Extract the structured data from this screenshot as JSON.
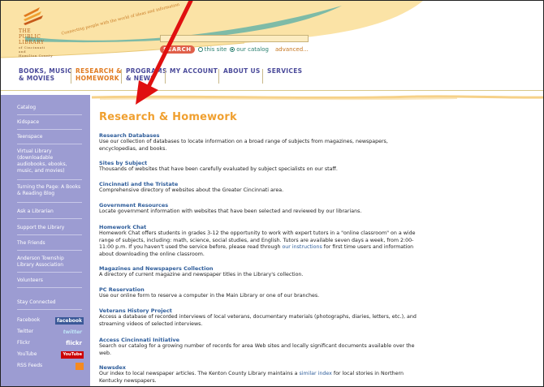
{
  "logo": {
    "line1": "THE",
    "line2": "PUBLIC",
    "line3": "LIBRARY",
    "line4": "of Cincinnati",
    "line5": "and",
    "line6": "Hamilton County",
    "tagline": "Connecting people with the world of ideas and information"
  },
  "search": {
    "button_label": "SEARCH",
    "option_site": "this site",
    "option_catalog": "our catalog",
    "advanced_label": "advanced...",
    "selected": "our catalog"
  },
  "nav": {
    "items": [
      {
        "line1": "BOOKS, MUSIC",
        "line2": "& MOVIES"
      },
      {
        "line1": "RESEARCH &",
        "line2": "HOMEWORK"
      },
      {
        "line1": "PROGRAMS",
        "line2": "& NEWS"
      },
      {
        "line1": "MY ACCOUNT",
        "line2": ""
      },
      {
        "line1": "ABOUT US",
        "line2": ""
      },
      {
        "line1": "SERVICES",
        "line2": ""
      }
    ]
  },
  "sidebar": {
    "items": [
      {
        "label": "Catalog"
      },
      {
        "label": "Kidspace"
      },
      {
        "label": "Teenspace"
      },
      {
        "label": "Virtual Library (downloadable audiobooks, ebooks, music, and movies)"
      },
      {
        "label": "Turning the Page: A Books & Reading Blog"
      },
      {
        "label": "Ask a Librarian"
      },
      {
        "label": "Support the Library"
      },
      {
        "label": "The Friends"
      },
      {
        "label": "Anderson Township Library Association"
      },
      {
        "label": "Volunteers"
      },
      {
        "label": "Stay Connected"
      }
    ],
    "social": [
      {
        "label": "Facebook",
        "badge": "facebook",
        "color": "#3b5998"
      },
      {
        "label": "Twitter",
        "badge": "twitter",
        "color": "#5ab7e6"
      },
      {
        "label": "Flickr",
        "badge": "flickr",
        "color": "#ffffff"
      },
      {
        "label": "YouTube",
        "badge": "YouTube",
        "color": "#cc0000"
      },
      {
        "label": "RSS Feeds",
        "badge": "rss",
        "color": "#f58a1f"
      }
    ]
  },
  "main": {
    "title": "Research & Homework",
    "entries": [
      {
        "title": "Research Databases",
        "desc": "Use our collection of databases to locate information on a broad range of subjects from magazines, newspapers, encyclopedias, and books."
      },
      {
        "title": "Sites by Subject",
        "desc": "Thousands of websites that have been carefully evaluated by subject specialists on our staff."
      },
      {
        "title": "Cincinnati and the Tristate",
        "desc": "Comprehensive directory of websites about the Greater Cincinnati area."
      },
      {
        "title": "Government Resources",
        "desc": "Locate government information with websites that have been selected and reviewed by our librarians."
      },
      {
        "title": "Homework Chat",
        "desc_a": "Homework Chat offers students in grades 3-12 the opportunity to work with expert tutors in a \"online classroom\" on a wide range of subjects, including: math, science, social studies, and English. Tutors are available seven days a week, from 2:00-11:00 p.m. If you haven't used the service before, please read through ",
        "desc_link": "our instructions",
        "desc_b": " for first time users and information about downloading the online classroom."
      },
      {
        "title": "Magazines and Newspapers Collection",
        "desc": "A directory of current magazine and newspaper titles in the Library's collection."
      },
      {
        "title": "PC Reservation",
        "desc": "Use our online form to reserve a computer in the Main Library or one of our branches."
      },
      {
        "title": "Veterans History Project",
        "desc": "Access a database of recorded interviews of local veterans, documentary materials (photographs, diaries, letters, etc.), and streaming videos of selected interviews."
      },
      {
        "title": "Access Cincinnati Initiative",
        "desc": "Search our catalog for a growing number of records for area Web sites and locally significant documents available over the web."
      },
      {
        "title": "Newsdex",
        "desc_a": "Our index to local newspaper articles. The Kenton County Library maintains a ",
        "desc_link": "similar index",
        "desc_b": " for local stories in Northern Kentucky newspapers."
      }
    ]
  },
  "colors": {
    "accent_orange": "#f0a030",
    "nav_blue": "#4a4a9a",
    "sidebar_bg": "#9c9cd2",
    "link_blue": "#2d5c9a",
    "arrow_red": "#e01010"
  }
}
